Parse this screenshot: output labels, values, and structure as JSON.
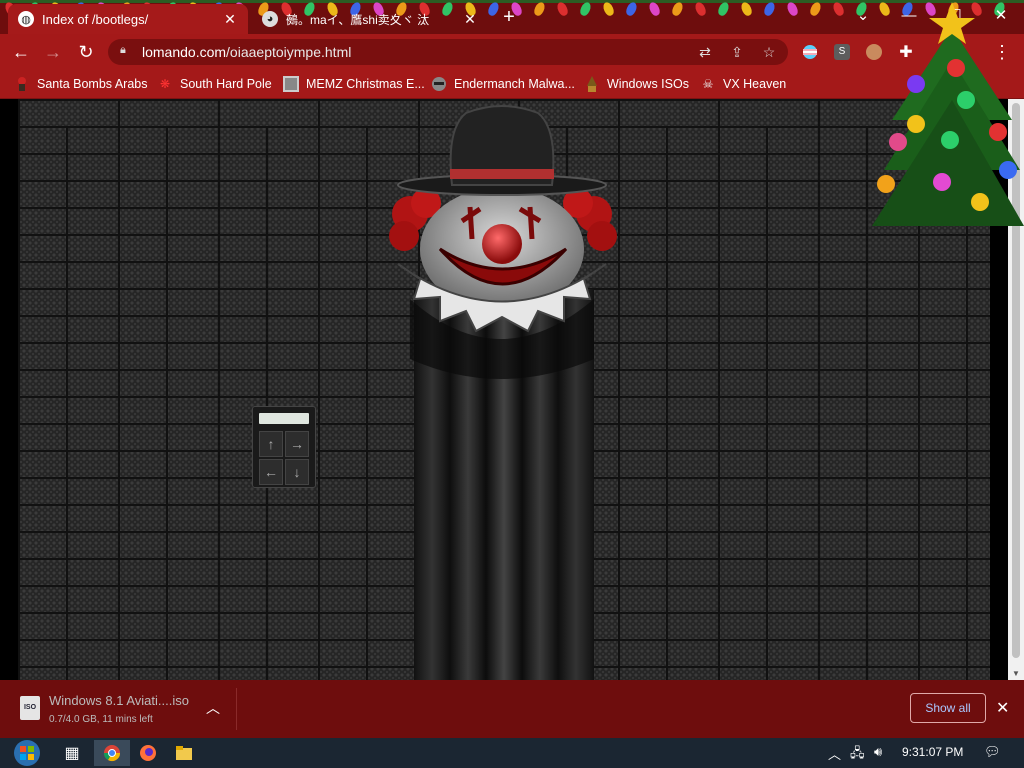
{
  "tabs": [
    {
      "title": "Index of /bootlegs/",
      "favicon": "globe-icon"
    },
    {
      "title": "鵺。maイ、鷹shi卖夊ヾ 汰",
      "favicon": "anime-avatar-icon"
    }
  ],
  "new_tab": "+",
  "window_controls": [
    "chevron-down-icon",
    "minimize-icon",
    "maximize-icon",
    "close-icon"
  ],
  "address_bar": {
    "host": "lomando.com",
    "path": "/oiaaeptoiympe.html"
  },
  "bookmarks": [
    {
      "label": "Santa Bombs Arabs",
      "icon": "santa-icon"
    },
    {
      "label": "South Hard Pole",
      "icon": "snowflake-icon"
    },
    {
      "label": "MEMZ Christmas E...",
      "icon": "memz-icon"
    },
    {
      "label": "Endermanch Malwa...",
      "icon": "raccoon-icon"
    },
    {
      "label": "Windows ISOs",
      "icon": "gnome-icon"
    },
    {
      "label": "VX Heaven",
      "icon": "skull-icon"
    }
  ],
  "game": {
    "keypad_keys": [
      "↑",
      "→",
      "←",
      "↓"
    ]
  },
  "download": {
    "filename": "Windows 8.1 Aviati....iso",
    "status": "0.7/4.0 GB, 11 mins left",
    "show_all": "Show all",
    "icon_text": "ISO"
  },
  "taskbar": {
    "clock": "9:31:07 PM",
    "apps": [
      "start-orb-icon",
      "task-view-icon",
      "chrome-icon",
      "firefox-icon",
      "file-explorer-icon"
    ]
  },
  "colors": {
    "tab_strip": "#6e0d0d",
    "toolbar": "#a41919",
    "download_bar": "#6e0d0d",
    "taskbar": "#1b2632",
    "brick": "#2d2d2d"
  }
}
